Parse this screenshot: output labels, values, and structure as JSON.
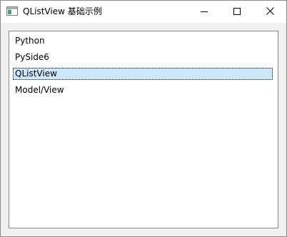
{
  "window": {
    "title": "QListView 基础示例",
    "icon": "app-window-icon"
  },
  "controls": {
    "minimize_icon": "minimize-icon",
    "maximize_icon": "maximize-icon",
    "close_icon": "close-icon"
  },
  "list": {
    "items": [
      {
        "label": "Python",
        "selected": false
      },
      {
        "label": "PySide6",
        "selected": false
      },
      {
        "label": "QListView",
        "selected": true
      },
      {
        "label": "Model/View",
        "selected": false
      }
    ],
    "selection_color": "#cce8ff"
  }
}
